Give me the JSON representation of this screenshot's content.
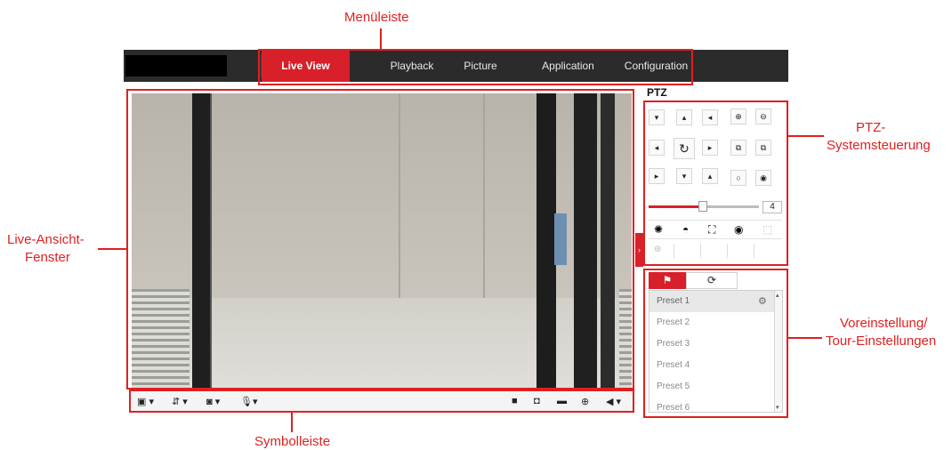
{
  "callouts": {
    "menu": "Menüleiste",
    "live_1": "Live-Ansicht-",
    "live_2": "Fenster",
    "ptz_1": "PTZ-",
    "ptz_2": "Systemsteuerung",
    "preset_1": "Voreinstellung/",
    "preset_2": "Tour-Einstellungen",
    "toolbar": "Symbolleiste"
  },
  "nav": {
    "tabs": [
      "Live View",
      "Playback",
      "Picture",
      "Application",
      "Configuration"
    ],
    "active": "Live View"
  },
  "ptz": {
    "title": "PTZ",
    "speed_value": "4",
    "speed_fraction": 0.5
  },
  "preset": {
    "items": [
      "Preset 1",
      "Preset 2",
      "Preset 3",
      "Preset 4",
      "Preset 5",
      "Preset 6"
    ],
    "selected": "Preset 1"
  },
  "colors": {
    "accent": "#d8202a",
    "annotation": "#e02020",
    "navbar": "#2b2b2b"
  },
  "icons": {
    "toolbar_left": [
      "window-layout-icon",
      "stream-type-icon",
      "plugin-icon",
      "microphone-icon"
    ],
    "toolbar_right": [
      "stop-icon",
      "camera-icon",
      "record-icon",
      "zoom-icon",
      "audio-mute-icon"
    ]
  }
}
